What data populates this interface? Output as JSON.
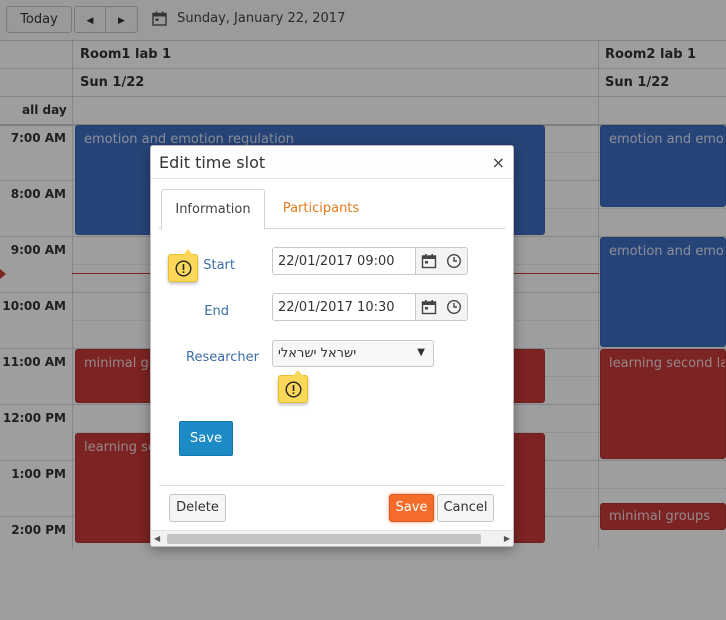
{
  "toolbar": {
    "today_label": "Today",
    "prev_label": "◀",
    "next_label": "▶",
    "current_date": "Sunday, January 22, 2017"
  },
  "resources": [
    {
      "name": "Room1 lab 1",
      "date": "Sun 1/22"
    },
    {
      "name": "Room2 lab 1",
      "date": "Sun 1/22"
    }
  ],
  "all_day_label": "all day",
  "time_slots": [
    "7:00 AM",
    "8:00 AM",
    "9:00 AM",
    "10:00 AM",
    "11:00 AM",
    "12:00 PM",
    "1:00 PM",
    "2:00 PM"
  ],
  "events": [
    {
      "title": "emotion and emotion regulation",
      "color": "#3f6fc2"
    },
    {
      "title": "minimal gr",
      "color": "#c8393b"
    },
    {
      "title": "learning se",
      "color": "#c8393b"
    },
    {
      "title": "emotion and emotio",
      "color": "#3f6fc2"
    },
    {
      "title": "emotion and emotio",
      "color": "#3f6fc2"
    },
    {
      "title": "learning second lan",
      "color": "#c8393b"
    },
    {
      "title": "minimal groups",
      "color": "#c8393b"
    }
  ],
  "modal": {
    "title": "Edit time slot",
    "close_label": "×",
    "tabs": [
      {
        "label": "Information",
        "active": true
      },
      {
        "label": "Participants",
        "active": false
      }
    ],
    "fields": {
      "start_label": "Start",
      "start_value": "22/01/2017 09:00",
      "end_label": "End",
      "end_value": "22/01/2017 10:30",
      "researcher_label": "Researcher",
      "researcher_value": "ישראל ישראלי"
    },
    "save_inner_label": "Save",
    "footer": {
      "delete_label": "Delete",
      "save_label": "Save",
      "cancel_label": "Cancel"
    }
  },
  "colors": {
    "event_blue": "#3f6fc2",
    "event_red": "#c8393b",
    "tab_accent": "#e47b1f",
    "primary_save": "#f46b2a",
    "inner_save": "#1c8bc6",
    "warning": "#fbd85a"
  }
}
